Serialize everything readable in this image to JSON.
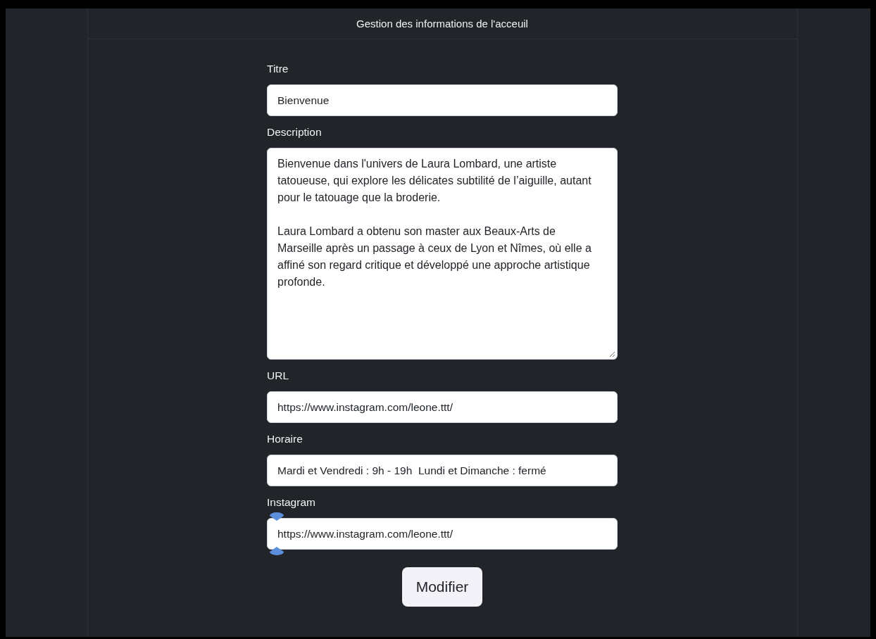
{
  "header": {
    "title": "Gestion des informations de l'acceuil"
  },
  "fields": [
    {
      "label": "Titre",
      "kind": "input",
      "value": "Bienvenue",
      "selection_handles": false
    },
    {
      "label": "Description",
      "kind": "textarea",
      "value": "Bienvenue dans l'univers de Laura Lombard, une artiste tatoueuse, qui explore les délicates subtilité de l’aiguille, autant pour le tatouage que la broderie.\n\nLaura Lombard a obtenu son master aux Beaux-Arts de Marseille après un passage à ceux de Lyon et Nîmes, où elle a affiné son regard critique et développé une approche artistique profonde.",
      "selection_handles": false
    },
    {
      "label": "URL",
      "kind": "input",
      "value": "https://www.instagram.com/leone.ttt/",
      "selection_handles": false
    },
    {
      "label": "Horaire",
      "kind": "input",
      "value": "Mardi et Vendredi : 9h - 19h  Lundi et Dimanche : fermé",
      "selection_handles": false
    },
    {
      "label": "Instagram",
      "kind": "input",
      "value": "https://www.instagram.com/leone.ttt/",
      "selection_handles": true
    }
  ],
  "submit_button": {
    "label": "Modifier"
  }
}
